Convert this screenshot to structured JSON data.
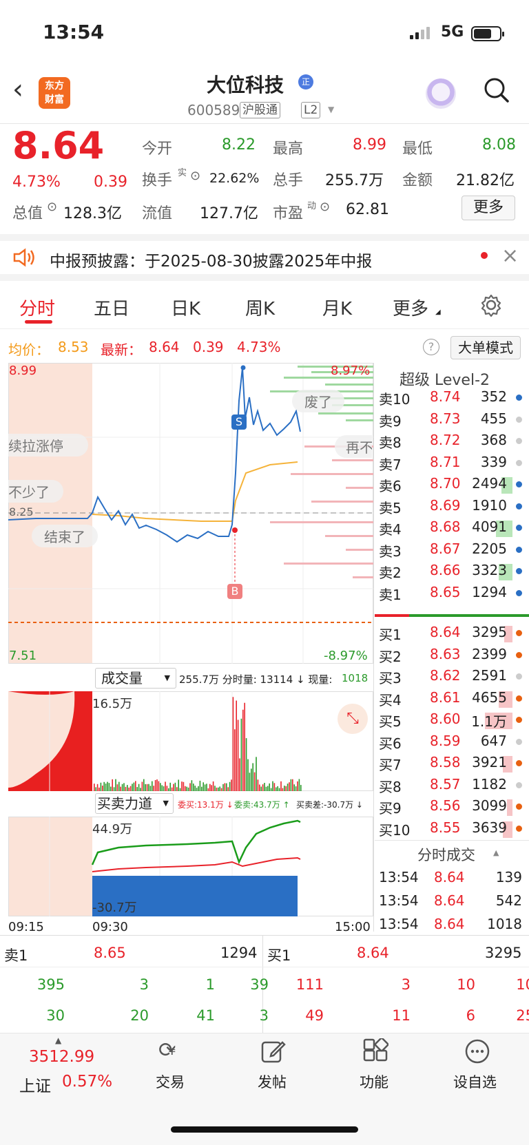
{
  "status": {
    "time": "13:54",
    "network": "5G"
  },
  "header": {
    "back": "‹",
    "logo": "东方财富",
    "title": "大位科技",
    "badge": "正",
    "code": "600589",
    "tags": [
      "沪股通",
      "L2"
    ]
  },
  "quote": {
    "price": "8.64",
    "pct": "4.73%",
    "chg": "0.39",
    "row1": [
      {
        "label": "今开",
        "value": "8.22",
        "color": "green"
      },
      {
        "label": "最高",
        "value": "8.99",
        "color": "red"
      },
      {
        "label": "最低",
        "value": "8.08",
        "color": "green"
      }
    ],
    "row2": [
      {
        "label": "换手",
        "sup": "实",
        "value": "22.62%"
      },
      {
        "label": "总手",
        "value": "255.7万"
      },
      {
        "label": "金额",
        "value": "21.82亿"
      }
    ],
    "row3": [
      {
        "label": "总值",
        "value": "128.3亿"
      },
      {
        "label": "流值",
        "value": "127.7亿"
      },
      {
        "label": "市盈",
        "sup": "动",
        "value": "62.81"
      }
    ],
    "more": "更多"
  },
  "notice": {
    "text": "中报预披露：于2025-08-30披露2025年中报",
    "close": "×"
  },
  "tabs": [
    "分时",
    "五日",
    "日K",
    "周K",
    "月K",
    "更多"
  ],
  "avgline": {
    "avg_label": "均价：",
    "avg": "8.53",
    "latest_label": "最新：",
    "latest": "8.64",
    "chg": "0.39",
    "pct": "4.73%",
    "mode": "大单模式"
  },
  "chart": {
    "top": "8.99",
    "top_pct": "8.97%",
    "bottom": "7.51",
    "bottom_pct": "-8.97%",
    "ref": "8.25",
    "marker_s": "S",
    "marker_b": "B",
    "danmu": [
      "废了",
      "续拉涨停",
      "再不亮",
      "不少了",
      "结束了"
    ],
    "volume": {
      "label": "成交量",
      "info": "255.7万 分时量: 13114 ↓ 现量:",
      "cur": "1018",
      "max": "16.5万"
    },
    "flow": {
      "label": "买卖力道",
      "buy": "委买:13.1万 ↓",
      "sell": "委卖:43.7万 ↑",
      "diff": "买卖差:-30.7万 ↓",
      "max": "44.9万",
      "min": "-30.7万"
    },
    "times": [
      "09:15",
      "09:30",
      "15:00"
    ]
  },
  "orderbook": {
    "title": "超级 Level-2",
    "sells": [
      [
        "卖10",
        "8.74",
        "352"
      ],
      [
        "卖9",
        "8.73",
        "455"
      ],
      [
        "卖8",
        "8.72",
        "368"
      ],
      [
        "卖7",
        "8.71",
        "339"
      ],
      [
        "卖6",
        "8.70",
        "2494"
      ],
      [
        "卖5",
        "8.69",
        "1910"
      ],
      [
        "卖4",
        "8.68",
        "4091"
      ],
      [
        "卖3",
        "8.67",
        "2205"
      ],
      [
        "卖2",
        "8.66",
        "3323"
      ],
      [
        "卖1",
        "8.65",
        "1294"
      ]
    ],
    "buys": [
      [
        "买1",
        "8.64",
        "3295"
      ],
      [
        "买2",
        "8.63",
        "2399"
      ],
      [
        "买3",
        "8.62",
        "2591"
      ],
      [
        "买4",
        "8.61",
        "4655"
      ],
      [
        "买5",
        "8.60",
        "1.1万"
      ],
      [
        "买6",
        "8.59",
        "647"
      ],
      [
        "买7",
        "8.58",
        "3921"
      ],
      [
        "买8",
        "8.57",
        "1182"
      ],
      [
        "买9",
        "8.56",
        "3099"
      ],
      [
        "买10",
        "8.55",
        "3639"
      ]
    ],
    "trades_title": "分时成交",
    "trades": [
      [
        "13:54",
        "8.64",
        "139"
      ],
      [
        "13:54",
        "8.64",
        "542"
      ],
      [
        "13:54",
        "8.64",
        "1018"
      ]
    ]
  },
  "queue": {
    "sell_label": "卖1",
    "sell_price": "8.65",
    "sell_vol": "1294",
    "buy_label": "买1",
    "buy_price": "8.64",
    "buy_vol": "3295",
    "sell_rows": [
      [
        "395",
        "3",
        "1",
        "39"
      ],
      [
        "30",
        "20",
        "41",
        "3"
      ]
    ],
    "buy_rows": [
      [
        "111",
        "3",
        "10",
        "10"
      ],
      [
        "49",
        "11",
        "6",
        "25"
      ]
    ]
  },
  "footer": {
    "index_value": "3512.99",
    "index_name": "上证",
    "index_pct": "0.57%",
    "items": [
      "交易",
      "发帖",
      "功能",
      "设自选"
    ]
  },
  "colors": {
    "red": "#e8222a",
    "green": "#2b9a2b",
    "blue": "#2a6fc4",
    "orange": "#f39a1a"
  }
}
